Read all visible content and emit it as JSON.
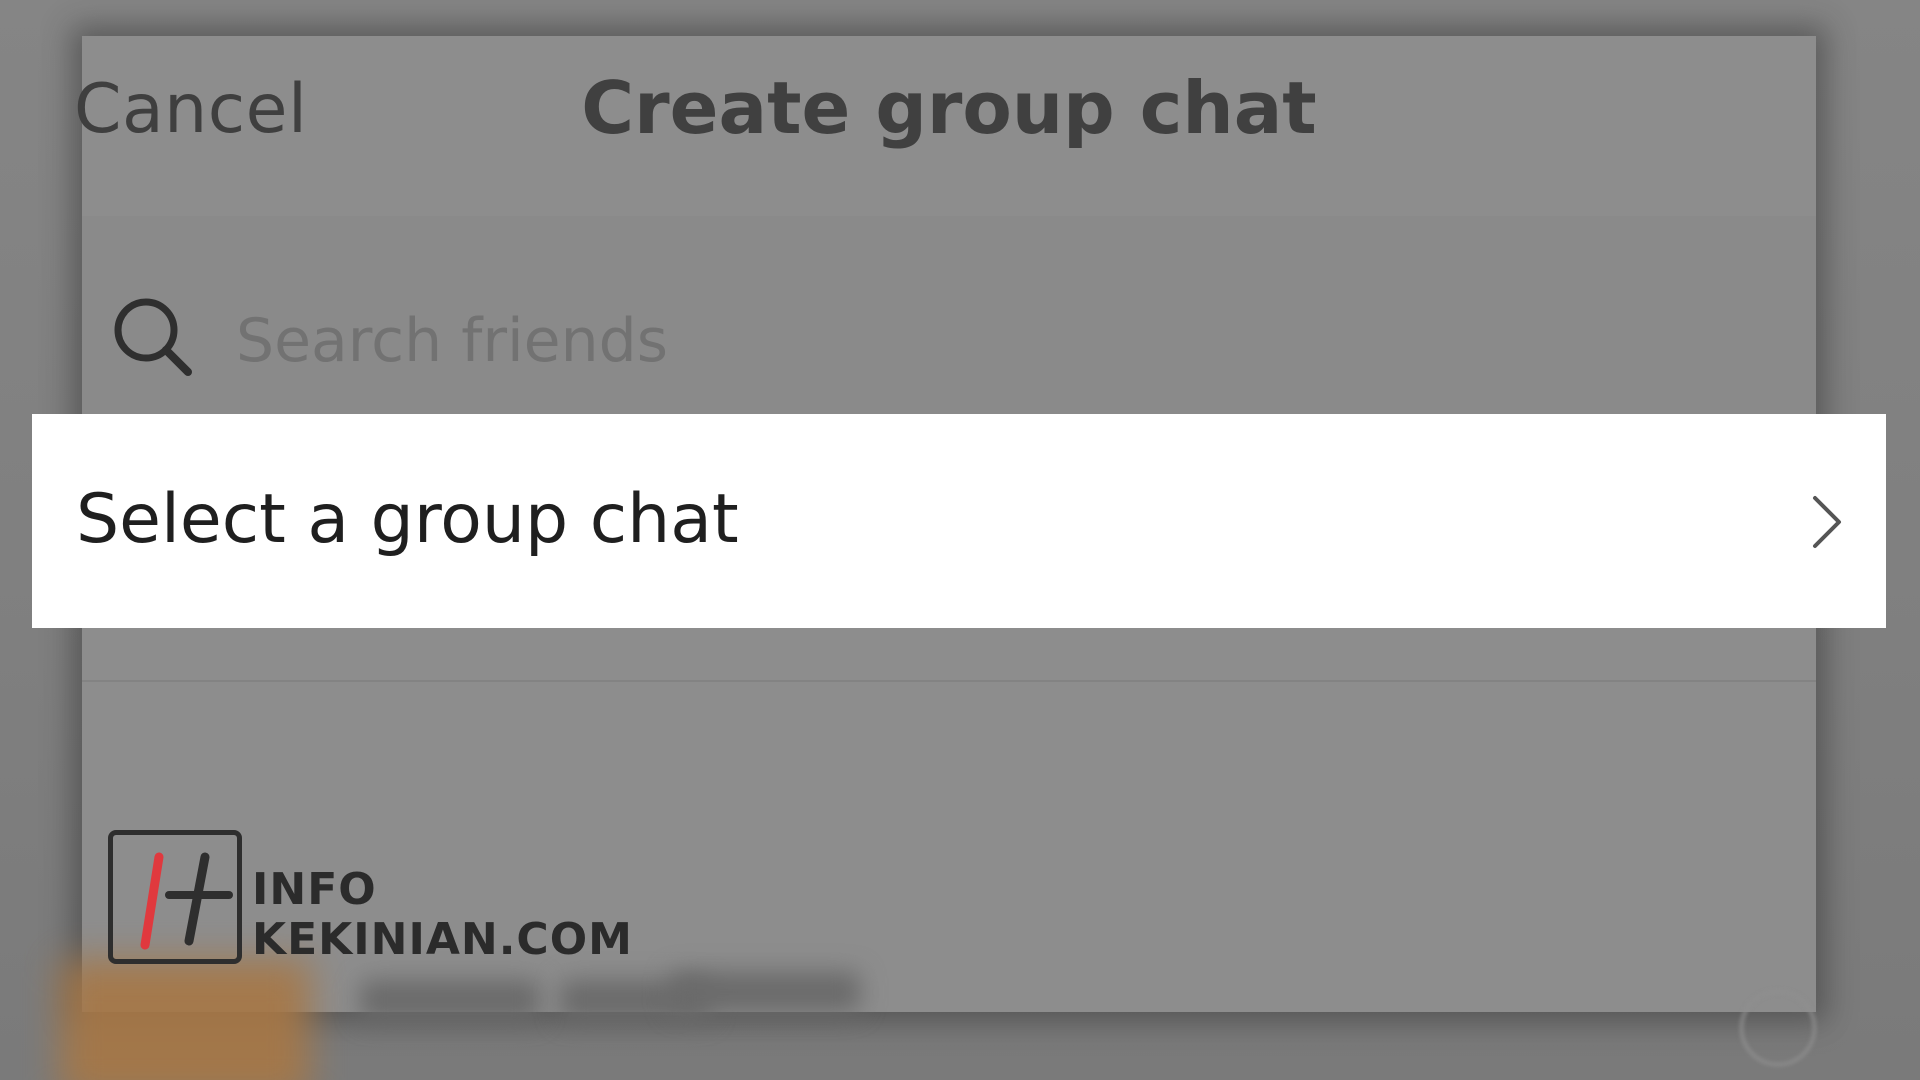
{
  "header": {
    "cancel_label": "Cancel",
    "title": "Create group chat"
  },
  "search": {
    "placeholder": "Search friends",
    "value": ""
  },
  "row": {
    "label": "Select a group chat"
  },
  "watermark": {
    "line1": "INFO",
    "line2": "KEKINIAN.COM",
    "accent_color": "#e0393e"
  },
  "icons": {
    "search": "search-icon",
    "chevron": "chevron-right-icon",
    "logo": "watermark-logo-icon"
  }
}
